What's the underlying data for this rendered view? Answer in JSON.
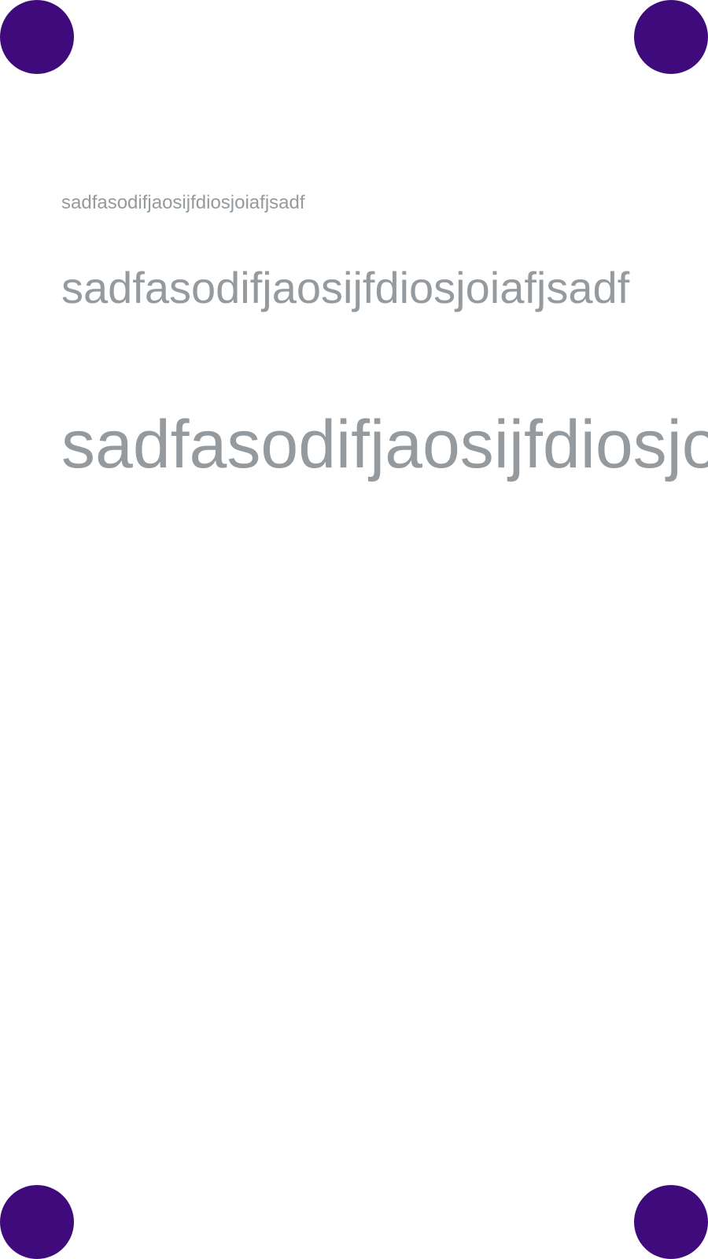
{
  "colors": {
    "dot": "#3f0b7c",
    "text": "#959a9e",
    "background": "#ffffff"
  },
  "samples": {
    "small": "sadfasodifjaosijfdiosjoiafjsadf",
    "medium": "sadfasodifjaosijfdiosjoiafjsadf",
    "large": "sadfasodifjaosijfdiosjoiafjsadf"
  }
}
